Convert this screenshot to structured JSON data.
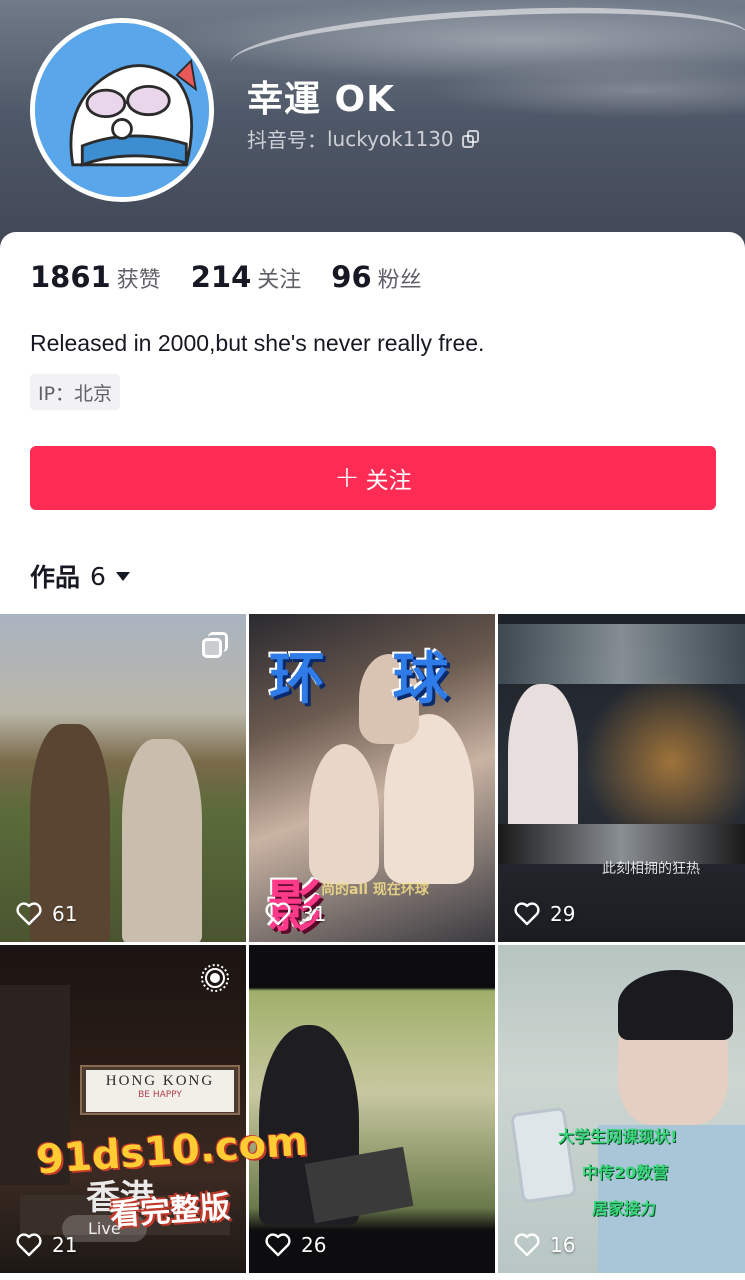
{
  "profile": {
    "nickname": "幸運 OK",
    "douyin_id_label": "抖音号：",
    "douyin_id": "luckyok1130",
    "bio": "Released in 2000,but she's never really free.",
    "ip": "IP：北京"
  },
  "stats": {
    "likes": {
      "value": "1861",
      "label": "获赞"
    },
    "following": {
      "value": "214",
      "label": "关注"
    },
    "followers": {
      "value": "96",
      "label": "粉丝"
    }
  },
  "follow_button": {
    "plus": "+",
    "label": "关注"
  },
  "works": {
    "label": "作品",
    "count": "6"
  },
  "videos": [
    {
      "likes": "61",
      "badge": "multi-image-icon"
    },
    {
      "likes": "31",
      "overlay_top": "环 球",
      "overlay_bottom": "影 城",
      "caption": "尚的all 现在环球"
    },
    {
      "likes": "29",
      "caption": "此刻相拥的狂热"
    },
    {
      "likes": "21",
      "badge": "live-photo-icon",
      "sign": "HONG KONG",
      "sign_sub": "BE  HAPPY",
      "caption": "香港",
      "live_label": "Live"
    },
    {
      "likes": "26"
    },
    {
      "likes": "16",
      "caption_lines": [
        "大学生网课现状!",
        "中传20数营",
        "居家接力"
      ]
    }
  ],
  "watermark": {
    "line1": "91ds10.com",
    "line2": "看完整版"
  },
  "colors": {
    "accent": "#fe2c55",
    "text": "#161823",
    "secondary": "#5f6167"
  }
}
